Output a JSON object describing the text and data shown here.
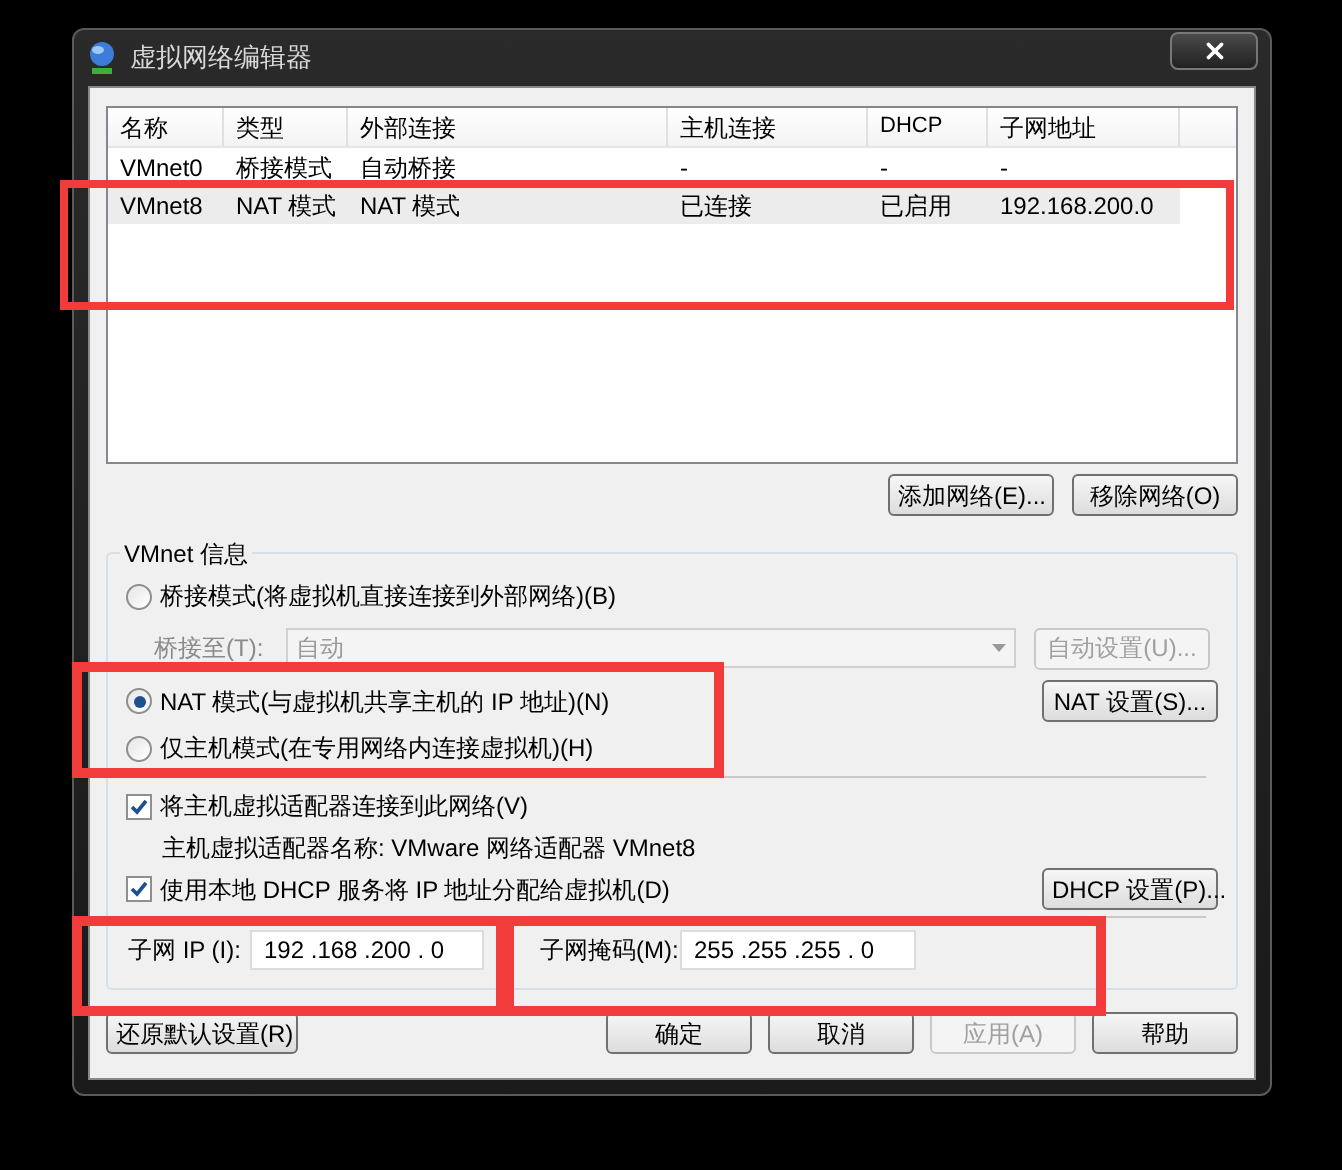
{
  "window": {
    "title": "虚拟网络编辑器"
  },
  "network_table": {
    "columns": [
      "名称",
      "类型",
      "外部连接",
      "主机连接",
      "DHCP",
      "子网地址"
    ],
    "rows": [
      {
        "cells": [
          "VMnet0",
          "桥接模式",
          "自动桥接",
          "-",
          "-",
          "-"
        ],
        "selected": false
      },
      {
        "cells": [
          "VMnet8",
          "NAT 模式",
          "NAT 模式",
          "已连接",
          "已启用",
          "192.168.200.0"
        ],
        "selected": true
      }
    ]
  },
  "table_buttons": [
    "添加网络(E)...",
    "移除网络(O)"
  ],
  "vmnet_info": {
    "title": "VMnet 信息",
    "modes": [
      {
        "label": "桥接模式(将虚拟机直接连接到外部网络)(B)",
        "selected": false
      },
      {
        "label": "NAT 模式(与虚拟机共享主机的 IP 地址)(N)",
        "selected": true
      },
      {
        "label": "仅主机模式(在专用网络内连接虚拟机)(H)",
        "selected": false
      }
    ],
    "bridge_to": {
      "label": "桥接至(T):",
      "value": "自动",
      "disabled": true
    },
    "auto_settings_button": {
      "label": "自动设置(U)...",
      "disabled": true
    },
    "nat_settings_button": "NAT 设置(S)...",
    "connect_adapter": {
      "label": "将主机虚拟适配器连接到此网络(V)",
      "checked": true
    },
    "adapter_name": "主机虚拟适配器名称: VMware 网络适配器 VMnet8",
    "use_dhcp": {
      "label": "使用本地 DHCP 服务将 IP 地址分配给虚拟机(D)",
      "checked": true
    },
    "dhcp_settings_button": "DHCP 设置(P)...",
    "subnet_ip": {
      "label": "子网 IP (I):",
      "value": "192 .168 .200 . 0"
    },
    "subnet_mask": {
      "label": "子网掩码(M):",
      "value": "255 .255 .255 . 0"
    }
  },
  "footer_buttons": [
    {
      "label": "还原默认设置(R)",
      "disabled": false
    },
    {
      "label": "确定",
      "disabled": false
    },
    {
      "label": "取消",
      "disabled": false
    },
    {
      "label": "应用(A)",
      "disabled": true
    },
    {
      "label": "帮助",
      "disabled": false
    }
  ],
  "annotations": [
    {
      "kind": "box"
    },
    {
      "kind": "box"
    },
    {
      "kind": "box"
    },
    {
      "kind": "box"
    }
  ]
}
